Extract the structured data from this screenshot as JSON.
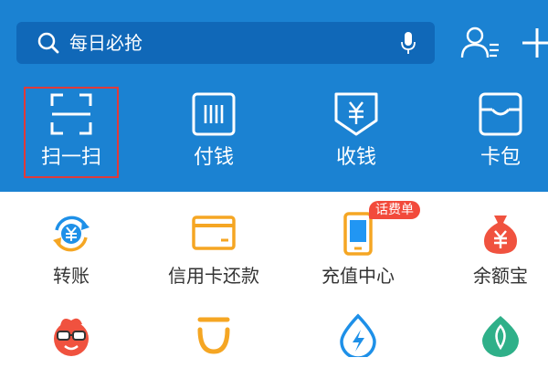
{
  "colors": {
    "header_bg": "#1b82d2",
    "search_bg": "#1068b8",
    "highlight_border": "#e03a3a",
    "badge_bg": "#f24a3b"
  },
  "search": {
    "placeholder": "每日必抢",
    "icon": "search-icon",
    "voice_icon": "mic-icon"
  },
  "header_actions": [
    {
      "icon": "contacts-icon"
    },
    {
      "icon": "add-icon"
    }
  ],
  "quick_actions": [
    {
      "label": "扫一扫",
      "icon": "scan-icon",
      "highlighted": true
    },
    {
      "label": "付钱",
      "icon": "pay-code-icon"
    },
    {
      "label": "收钱",
      "icon": "receive-money-icon"
    },
    {
      "label": "卡包",
      "icon": "card-wallet-icon"
    }
  ],
  "services_row1": [
    {
      "label": "转账",
      "icon": "transfer-icon"
    },
    {
      "label": "信用卡还款",
      "icon": "credit-card-icon"
    },
    {
      "label": "充值中心",
      "icon": "mobile-topup-icon",
      "badge": "话费单"
    },
    {
      "label": "余额宝",
      "icon": "money-bag-icon"
    }
  ],
  "services_row2": [
    {
      "icon": "movie-mascot-icon"
    },
    {
      "icon": "ride-hailing-icon"
    },
    {
      "icon": "utilities-icon"
    },
    {
      "icon": "green-energy-icon"
    }
  ]
}
